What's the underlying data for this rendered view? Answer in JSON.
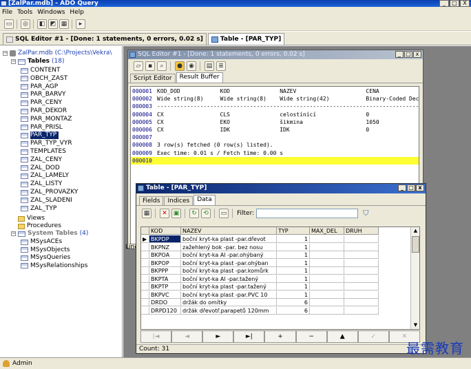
{
  "window": {
    "title": "[ZalPar.mdb] - ADO Query",
    "min": "_",
    "max": "□",
    "close": "X"
  },
  "menu": [
    "File",
    "Tools",
    "Windows",
    "Help"
  ],
  "doc_tabs": [
    {
      "label": "SQL Editor #1 - [Done: 1 statements, 0 errors, 0.02 s]"
    },
    {
      "label": "Table - [PAR_TYP]"
    }
  ],
  "tree": {
    "root": "ZalPar.mdb",
    "root_path": "(C:\\Projects\\Vekra\\",
    "tables_label": "Tables",
    "tables_count": "(18)",
    "tables": [
      "CONTENT",
      "OBCH_ZAST",
      "PAR_AGP",
      "PAR_BARVY",
      "PAR_CENY",
      "PAR_DEKOR",
      "PAR_MONTAZ",
      "PAR_PRISL",
      "PAR_TYP",
      "PAR_TYP_VYR",
      "TEMPLATES",
      "ZAL_CENY",
      "ZAL_DOD",
      "ZAL_LAMELY",
      "ZAL_LISTY",
      "ZAL_PROVAZKY",
      "ZAL_SLADENI",
      "ZAL_TYP"
    ],
    "selected": "PAR_TYP",
    "views": "Views",
    "procedures": "Procedures",
    "system_label": "System Tables",
    "system_count": "(4)",
    "system": [
      "MSysACEs",
      "MSysObjects",
      "MSysQueries",
      "MSysRelationships"
    ]
  },
  "sql_editor": {
    "title": "SQL Editor #1 - [Done: 1 statements, 0 errors, 0.02 s]",
    "tabs": [
      "Script Editor",
      "Result Buffer"
    ],
    "active_tab": "Result Buffer",
    "lines": [
      {
        "no": "000001",
        "text": "KOD_DOD            KOD               NAZEV                     CENA"
      },
      {
        "no": "000002",
        "text": "Wide string(8)     Wide string(8)    Wide string(42)           Binary-Coded Dec:"
      },
      {
        "no": "000003",
        "text": "-------------------------------------------------------------------------------------"
      },
      {
        "no": "000004",
        "text": "CX                 CLS               celostínící               0"
      },
      {
        "no": "000005",
        "text": "CX                 EKO               šikmina                   1050"
      },
      {
        "no": "000006",
        "text": "CX                 IDK               IDK                       0"
      },
      {
        "no": "000007",
        "text": ""
      },
      {
        "no": "000008",
        "text": "3 row(s) fetched (0 row(s) listed)."
      },
      {
        "no": "000009",
        "text": "Exec time: 0.01 s / Fetch time: 0.00 s"
      },
      {
        "no": "000010",
        "text": ""
      }
    ]
  },
  "line_label": "Line",
  "table_win": {
    "title": "Table - [PAR_TYP]",
    "tabs": [
      "Fields",
      "Indices",
      "Data"
    ],
    "active_tab": "Data",
    "filter_label": "Filter:",
    "columns": [
      "KOD",
      "NAZEV",
      "TYP",
      "MAX_DEL",
      "DRUH"
    ],
    "rows": [
      [
        "BKPDP",
        "boční kryt-ka plast -par.dřevot",
        "1",
        "",
        ""
      ],
      [
        "BKPNZ",
        "zažehlený bok -par. bez nosu",
        "1",
        "",
        ""
      ],
      [
        "BKPOA",
        "boční kryt-ka Al -par.ohýbaný",
        "1",
        "",
        ""
      ],
      [
        "BKPOP",
        "boční kryt-ka plast -par.ohýban",
        "1",
        "",
        ""
      ],
      [
        "BKPPP",
        "boční kryt-ka plast -par.komůrk",
        "1",
        "",
        ""
      ],
      [
        "BKPTA",
        "boční kryt-ka Al -par.tažený",
        "1",
        "",
        ""
      ],
      [
        "BKPTP",
        "boční kryt-ka plast -par.tažený",
        "1",
        "",
        ""
      ],
      [
        "BKPVC",
        "boční kryt-ka plast -par.PVC 10",
        "1",
        "",
        ""
      ],
      [
        "DRDO",
        "držák do omítky",
        "6",
        "",
        ""
      ],
      [
        "DRPD120",
        "držák dřevotř.parapetů 120mm",
        "6",
        "",
        ""
      ]
    ],
    "nav": [
      "|◄",
      "◄",
      "►",
      "►|",
      "+",
      "−",
      "▲",
      "✓",
      "✕"
    ],
    "count": "Count: 31"
  },
  "status": {
    "user": "Admin"
  },
  "watermark": "最需教育"
}
